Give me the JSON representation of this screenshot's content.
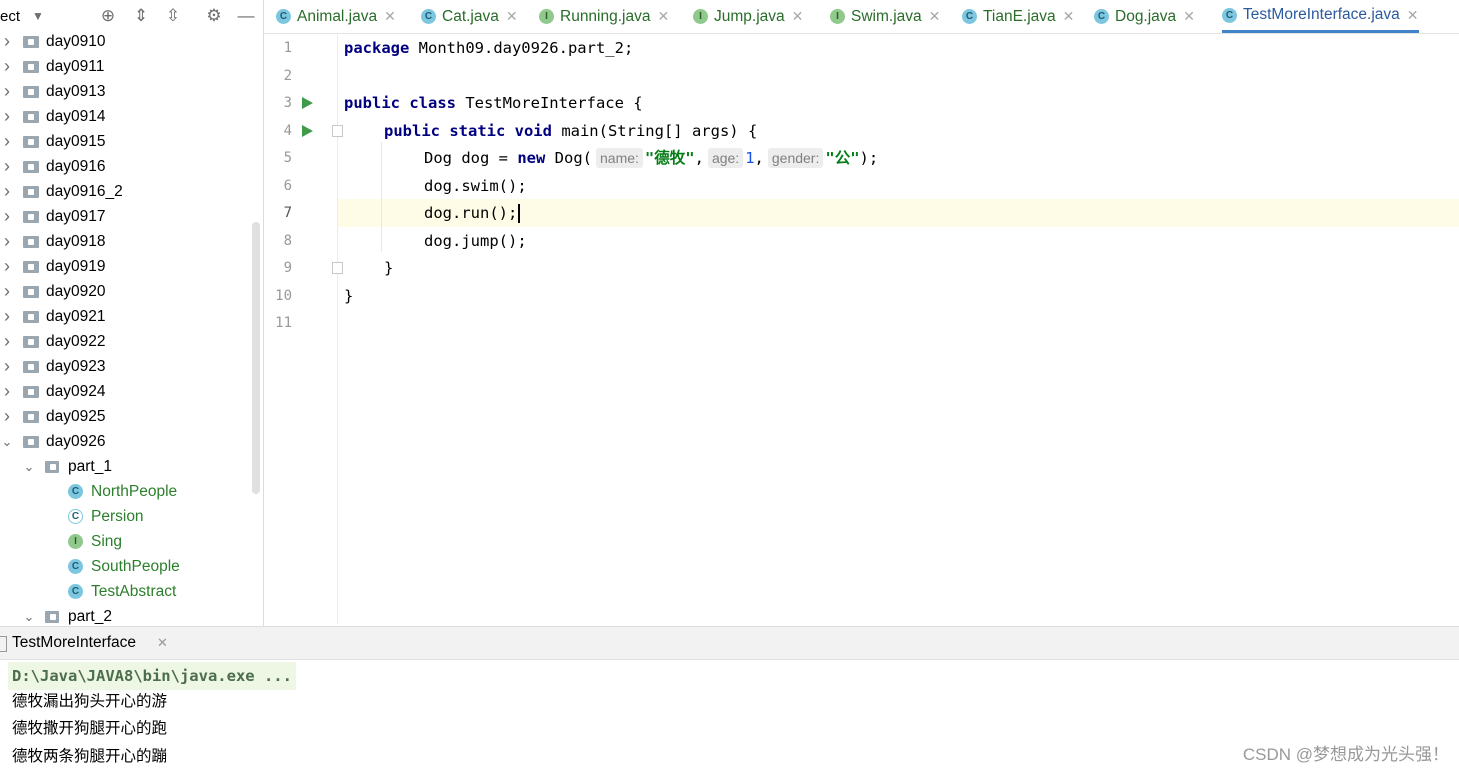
{
  "sidebar": {
    "title": "ect",
    "tools": [
      "crosshair-icon",
      "expand-all-icon",
      "collapse-all-icon",
      "gear-icon",
      "minimize-icon"
    ],
    "tree": [
      {
        "label": "day0910",
        "type": "folder",
        "depth": 0,
        "expanded": false
      },
      {
        "label": "day0911",
        "type": "folder",
        "depth": 0,
        "expanded": false
      },
      {
        "label": "day0913",
        "type": "folder",
        "depth": 0,
        "expanded": false
      },
      {
        "label": "day0914",
        "type": "folder",
        "depth": 0,
        "expanded": false
      },
      {
        "label": "day0915",
        "type": "folder",
        "depth": 0,
        "expanded": false
      },
      {
        "label": "day0916",
        "type": "folder",
        "depth": 0,
        "expanded": false
      },
      {
        "label": "day0916_2",
        "type": "folder",
        "depth": 0,
        "expanded": false
      },
      {
        "label": "day0917",
        "type": "folder",
        "depth": 0,
        "expanded": false
      },
      {
        "label": "day0918",
        "type": "folder",
        "depth": 0,
        "expanded": false
      },
      {
        "label": "day0919",
        "type": "folder",
        "depth": 0,
        "expanded": false
      },
      {
        "label": "day0920",
        "type": "folder",
        "depth": 0,
        "expanded": false
      },
      {
        "label": "day0921",
        "type": "folder",
        "depth": 0,
        "expanded": false
      },
      {
        "label": "day0922",
        "type": "folder",
        "depth": 0,
        "expanded": false
      },
      {
        "label": "day0923",
        "type": "folder",
        "depth": 0,
        "expanded": false
      },
      {
        "label": "day0924",
        "type": "folder",
        "depth": 0,
        "expanded": false
      },
      {
        "label": "day0925",
        "type": "folder",
        "depth": 0,
        "expanded": false
      },
      {
        "label": "day0926",
        "type": "folder",
        "depth": 0,
        "expanded": true
      },
      {
        "label": "part_1",
        "type": "package",
        "depth": 1,
        "expanded": true
      },
      {
        "label": "NorthPeople",
        "type": "class",
        "depth": 2
      },
      {
        "label": "Persion",
        "type": "abstract",
        "depth": 2
      },
      {
        "label": "Sing",
        "type": "interface",
        "depth": 2
      },
      {
        "label": "SouthPeople",
        "type": "class",
        "depth": 2
      },
      {
        "label": "TestAbstract",
        "type": "runnable",
        "depth": 2
      },
      {
        "label": "part_2",
        "type": "package",
        "depth": 1,
        "expanded": true
      }
    ]
  },
  "tabs": [
    {
      "label": "Animal.java",
      "kind": "c",
      "active": false
    },
    {
      "label": "Cat.java",
      "kind": "c",
      "active": false
    },
    {
      "label": "Running.java",
      "kind": "i",
      "active": false
    },
    {
      "label": "Jump.java",
      "kind": "i",
      "active": false
    },
    {
      "label": "Swim.java",
      "kind": "i",
      "active": false
    },
    {
      "label": "TianE.java",
      "kind": "c",
      "active": false
    },
    {
      "label": "Dog.java",
      "kind": "c",
      "active": false
    },
    {
      "label": "TestMoreInterface.java",
      "kind": "c",
      "active": true
    }
  ],
  "editor": {
    "line_numbers": [
      "1",
      "2",
      "3",
      "4",
      "5",
      "6",
      "7",
      "8",
      "9",
      "10",
      "11"
    ],
    "current_line": 7,
    "code": {
      "l1_kw": "package",
      "l1_rest": " Month09.day0926.part_2;",
      "l3_kw": "public class",
      "l3_rest": " TestMoreInterface {",
      "l4_kw": "public static void",
      "l4_rest": " main(String[] args) {",
      "l5_a": "Dog dog = ",
      "l5_kw": "new",
      "l5_b": " Dog(",
      "l5_hint_name": "name:",
      "l5_str1": "\"德牧\"",
      "l5_c1": ",",
      "l5_hint_age": "age:",
      "l5_num": "1",
      "l5_c2": ",",
      "l5_hint_gender": "gender:",
      "l5_str2": "\"公\"",
      "l5_end": ");",
      "l6": "dog.swim();",
      "l7": "dog.run();",
      "l8": "dog.jump();",
      "l9": "}",
      "l10": "}"
    }
  },
  "run_panel": {
    "tab_label": "TestMoreInterface",
    "command": "D:\\Java\\JAVA8\\bin\\java.exe ...",
    "output": [
      "德牧漏出狗头开心的游",
      "德牧撒开狗腿开心的跑",
      "德牧两条狗腿开心的蹦"
    ]
  },
  "watermark": "CSDN @梦想成为光头强！"
}
